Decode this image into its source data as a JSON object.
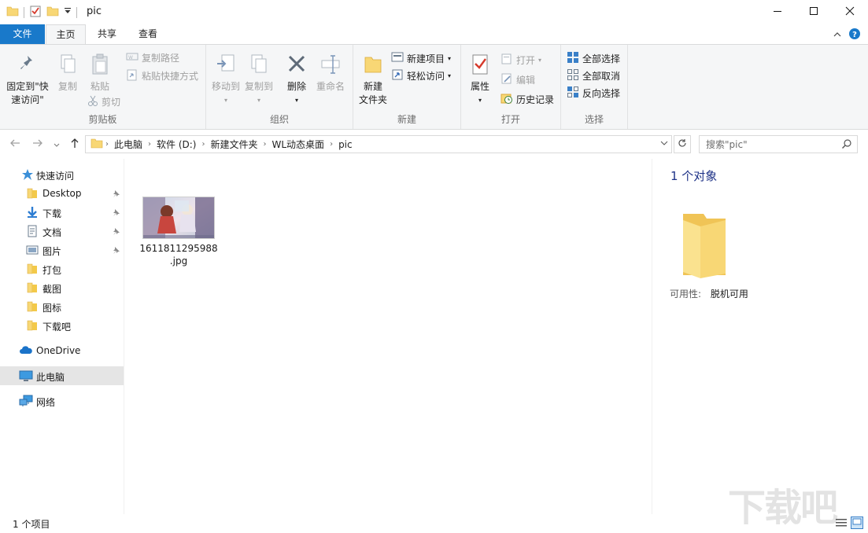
{
  "window": {
    "title": "pic",
    "minimize_icon": "minimize-icon",
    "maximize_icon": "maximize-icon",
    "close_icon": "close-icon"
  },
  "tabs": [
    {
      "label": "文件"
    },
    {
      "label": "主页"
    },
    {
      "label": "共享"
    },
    {
      "label": "查看"
    }
  ],
  "ribbon": {
    "clipboard": {
      "label": "剪贴板",
      "pin": "固定到\"快",
      "pin2": "速访问\"",
      "copy": "复制",
      "paste": "粘贴",
      "copy_path": "复制路径",
      "paste_shortcut": "粘贴快捷方式",
      "cut": "剪切"
    },
    "organize": {
      "label": "组织",
      "move_to": "移动到",
      "copy_to": "复制到",
      "delete": "删除",
      "rename": "重命名"
    },
    "new": {
      "label": "新建",
      "new_folder_1": "新建",
      "new_folder_2": "文件夹",
      "new_item": "新建项目",
      "easy_access": "轻松访问"
    },
    "open": {
      "label": "打开",
      "properties": "属性",
      "open": "打开",
      "edit": "编辑",
      "history": "历史记录"
    },
    "select": {
      "label": "选择",
      "select_all": "全部选择",
      "select_none": "全部取消",
      "invert": "反向选择"
    }
  },
  "address": {
    "crumbs": [
      "此电脑",
      "软件 (D:)",
      "新建文件夹",
      "WL动态桌面",
      "pic"
    ]
  },
  "search": {
    "placeholder": "搜索\"pic\""
  },
  "nav": {
    "quick_access": "快速访问",
    "items": [
      {
        "label": "Desktop"
      },
      {
        "label": "下载"
      },
      {
        "label": "文档"
      },
      {
        "label": "图片"
      },
      {
        "label": "打包"
      },
      {
        "label": "截图"
      },
      {
        "label": "图标"
      },
      {
        "label": "下载吧"
      }
    ],
    "onedrive": "OneDrive",
    "this_pc": "此电脑",
    "network": "网络"
  },
  "content": {
    "file_name_1": "1611811295988",
    "file_name_2": ".jpg"
  },
  "details": {
    "count": "1 个对象",
    "availability_label": "可用性:",
    "availability_value": "脱机可用"
  },
  "status": {
    "items": "1 个项目"
  },
  "colors": {
    "accent": "#1979ca",
    "folder": "#f8d775",
    "details_title": "#1e3287"
  }
}
